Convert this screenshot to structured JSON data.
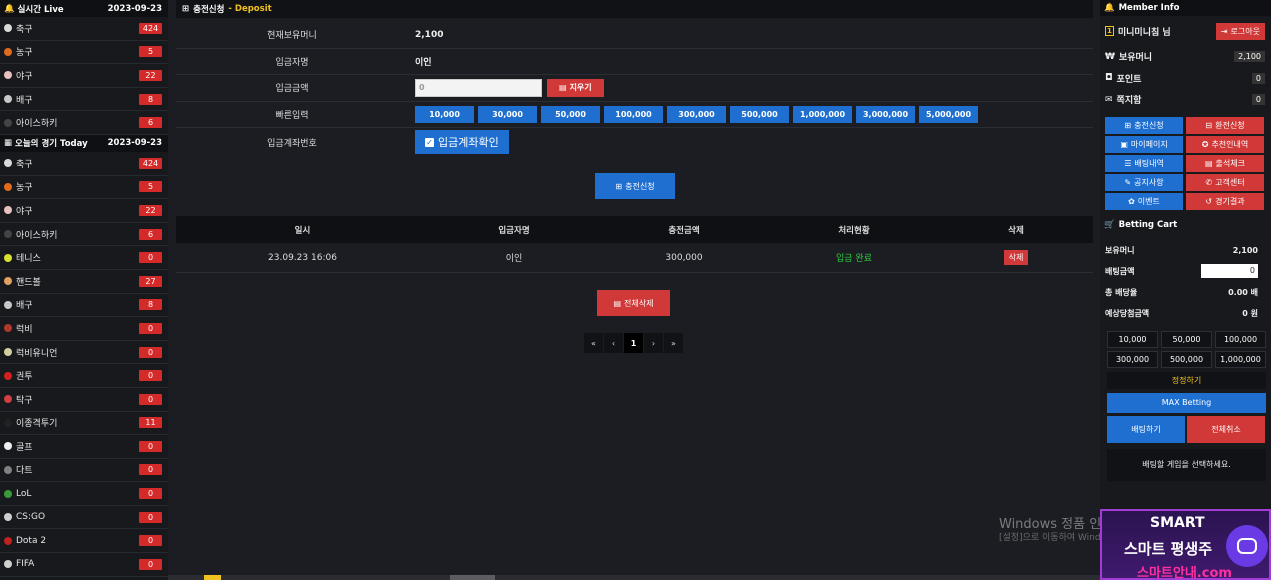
{
  "left": {
    "live_title": "실시간 Live",
    "live_date": "2023-09-23",
    "live_sports": [
      {
        "name": "축구",
        "count": "424",
        "color": "#d9d9d9"
      },
      {
        "name": "농구",
        "count": "5",
        "color": "#e06a1b"
      },
      {
        "name": "야구",
        "count": "22",
        "color": "#e9c0c0"
      },
      {
        "name": "배구",
        "count": "8",
        "color": "#c8c8c8"
      },
      {
        "name": "아이스하키",
        "count": "6",
        "color": "#444444"
      }
    ],
    "today_title": "오늘의 경기 Today",
    "today_date": "2023-09-23",
    "today_sports": [
      {
        "name": "축구",
        "count": "424",
        "color": "#d9d9d9"
      },
      {
        "name": "농구",
        "count": "5",
        "color": "#e06a1b"
      },
      {
        "name": "야구",
        "count": "22",
        "color": "#e9c0c0"
      },
      {
        "name": "아이스하키",
        "count": "6",
        "color": "#444444"
      },
      {
        "name": "테니스",
        "count": "0",
        "color": "#d8e030"
      },
      {
        "name": "핸드볼",
        "count": "27",
        "color": "#e0a060"
      },
      {
        "name": "배구",
        "count": "8",
        "color": "#c8c8c8"
      },
      {
        "name": "럭비",
        "count": "0",
        "color": "#b03a2a"
      },
      {
        "name": "럭비유니언",
        "count": "0",
        "color": "#d0d0a0"
      },
      {
        "name": "권투",
        "count": "0",
        "color": "#d02020"
      },
      {
        "name": "탁구",
        "count": "0",
        "color": "#d04040"
      },
      {
        "name": "이종격투기",
        "count": "11",
        "color": "#222222"
      },
      {
        "name": "골프",
        "count": "0",
        "color": "#f0f0f0"
      },
      {
        "name": "다트",
        "count": "0",
        "color": "#808080"
      },
      {
        "name": "LoL",
        "count": "0",
        "color": "#3a9a3a"
      },
      {
        "name": "CS:GO",
        "count": "0",
        "color": "#d0d0d0"
      },
      {
        "name": "Dota 2",
        "count": "0",
        "color": "#c02020"
      },
      {
        "name": "FIFA",
        "count": "0",
        "color": "#d0d0d0"
      }
    ]
  },
  "main": {
    "title": "충전신청",
    "subtitle": "- Deposit",
    "rows": {
      "balance_label": "현재보유머니",
      "balance_value": "2,100",
      "depositor_label": "입금자명",
      "depositor_value": "이인",
      "amount_label": "입금금액",
      "amount_value": "0",
      "clear_label": "지우기",
      "quick_label": "빠른입력",
      "account_label": "입금계좌번호",
      "account_button": "입금계좌확인"
    },
    "quick_amounts": [
      "10,000",
      "30,000",
      "50,000",
      "100,000",
      "300,000",
      "500,000",
      "1,000,000",
      "3,000,000",
      "5,000,000"
    ],
    "submit_label": "충전신청",
    "table": {
      "headers": [
        "일시",
        "입금자명",
        "충전금액",
        "처리현황",
        "삭제"
      ],
      "rows": [
        {
          "date": "23.09.23 16:06",
          "name": "이인",
          "amount": "300,000",
          "status": "입금 완료",
          "delete": "삭제"
        }
      ]
    },
    "delete_all_label": "전체삭제",
    "pager": [
      "«",
      "‹",
      "1",
      "›",
      "»"
    ]
  },
  "right": {
    "member_title": "Member Info",
    "nickname": "미니미니침 님",
    "logout_label": "로그아웃",
    "money_label": "보유머니",
    "money_value": "2,100",
    "point_label": "포인트",
    "point_value": "0",
    "note_label": "쪽지함",
    "note_value": "0",
    "menu": [
      {
        "label": "충전신청",
        "style": "b"
      },
      {
        "label": "환전신청",
        "style": "r"
      },
      {
        "label": "마이페이지",
        "style": "b"
      },
      {
        "label": "추천인내역",
        "style": "r"
      },
      {
        "label": "배팅내역",
        "style": "b"
      },
      {
        "label": "출석체크",
        "style": "r"
      },
      {
        "label": "공지사항",
        "style": "b"
      },
      {
        "label": "고객센터",
        "style": "r"
      },
      {
        "label": "이벤트",
        "style": "b"
      },
      {
        "label": "경기결과",
        "style": "r"
      }
    ],
    "cart_title": "Betting Cart",
    "cart_money_label": "보유머니",
    "cart_money_value": "2,100",
    "bet_amount_label": "배팅금액",
    "bet_amount_value": "0",
    "total_odds_label": "총 배당율",
    "total_odds_value": "0.00 배",
    "expected_label": "예상당첨금액",
    "expected_value": "0 원",
    "quick": [
      "10,000",
      "50,000",
      "100,000",
      "300,000",
      "500,000",
      "1,000,000"
    ],
    "reset_label": "정정하기",
    "max_label": "MAX Betting",
    "bet_label": "배팅하기",
    "cancel_label": "전체취소",
    "message": "배팅할 게임을 선택하세요."
  },
  "overlay": {
    "windows_line1": "Windows 정품 인증",
    "windows_line2": "[설정]으로 이동하여 Windows를",
    "ad_line1": "SMART",
    "ad_line2": "스마트 평생주",
    "ad_line3": "스마트안내.com"
  },
  "colors": {
    "accent_blue": "#1f6fd0",
    "accent_red": "#d13838",
    "status_green": "#2ecc40"
  }
}
